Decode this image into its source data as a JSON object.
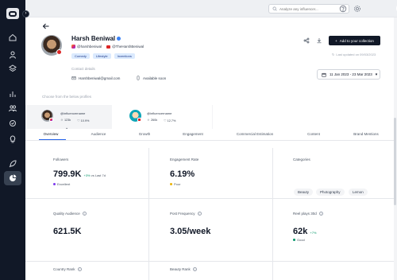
{
  "topbar": {
    "search_placeholder": "Analyze any influencer..."
  },
  "profile": {
    "name": "Harsh Beniwal",
    "instagram_handle": "@harshbeniwal",
    "youtube_handle": "@TheHarshBeniwal",
    "tags": [
      "Comedy",
      "Lifestyle",
      "Inventions"
    ],
    "contact_title": "Contact details",
    "email": "Harshbeniwal@gmail.com",
    "phone": "Available soon"
  },
  "actions": {
    "add_collection_label": "Add to your collection",
    "last_updated": "Last updated on 09/03/2023",
    "date_range": "11 Jan 2023 - 23 Mar 2023"
  },
  "accounts": {
    "choose_label": "Choose from the below profiles",
    "items": [
      {
        "username": "@influencername",
        "followers": "123k",
        "engagement": "10.9%"
      },
      {
        "username": "@influencername",
        "followers": "260k",
        "engagement": "12.7%"
      }
    ]
  },
  "tabs": [
    "Overview",
    "Audience",
    "Growth",
    "Engagement",
    "Commercial Estimation",
    "Content",
    "Brand Mentions"
  ],
  "metrics": {
    "followers": {
      "title": "Followers",
      "value": "799.9K",
      "change": "+3%",
      "change_suffix": "vs Last 7d",
      "status": "Excellent",
      "status_color": "#7c3aed"
    },
    "engagement_rate": {
      "title": "Engagement Rate",
      "value": "6.19%",
      "status": "Poor",
      "status_color": "#eab308"
    },
    "categories": {
      "title": "Categories",
      "items": [
        "Beauty",
        "Photography",
        "Lemon"
      ]
    },
    "quality_audience": {
      "title": "Quality Audience",
      "value": "621.5K"
    },
    "post_frequency": {
      "title": "Post Frequency",
      "value": "3.05/week"
    },
    "reel_plays": {
      "title": "Reel plays 30d",
      "value": "62k",
      "change": "+7%",
      "status": "Good",
      "status_color": "#059669"
    },
    "country_rank": {
      "title": "Country Rank"
    },
    "beauty_rank": {
      "title": "Beauty Rank"
    }
  },
  "colors": {
    "sidebar": "#111827",
    "accent": "#2563eb",
    "button": "#111827"
  }
}
